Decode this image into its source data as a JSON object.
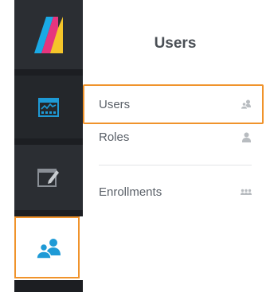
{
  "app": {
    "logo_icon": "logo-icon"
  },
  "rail": {
    "items": [
      {
        "name": "dashboard",
        "icon": "dashboard-icon",
        "active": false
      },
      {
        "name": "editor",
        "icon": "edit-window-icon",
        "active": false
      },
      {
        "name": "users",
        "icon": "users-icon",
        "active": true
      }
    ],
    "active_color": "#1e9ad6"
  },
  "panel": {
    "title": "Users",
    "items": [
      {
        "label": "Users",
        "icon": "users-small-icon"
      },
      {
        "label": "Roles",
        "icon": "user-small-icon"
      },
      {
        "label": "Enrollments",
        "icon": "group-small-icon"
      }
    ]
  },
  "highlight_color": "#f0932b"
}
